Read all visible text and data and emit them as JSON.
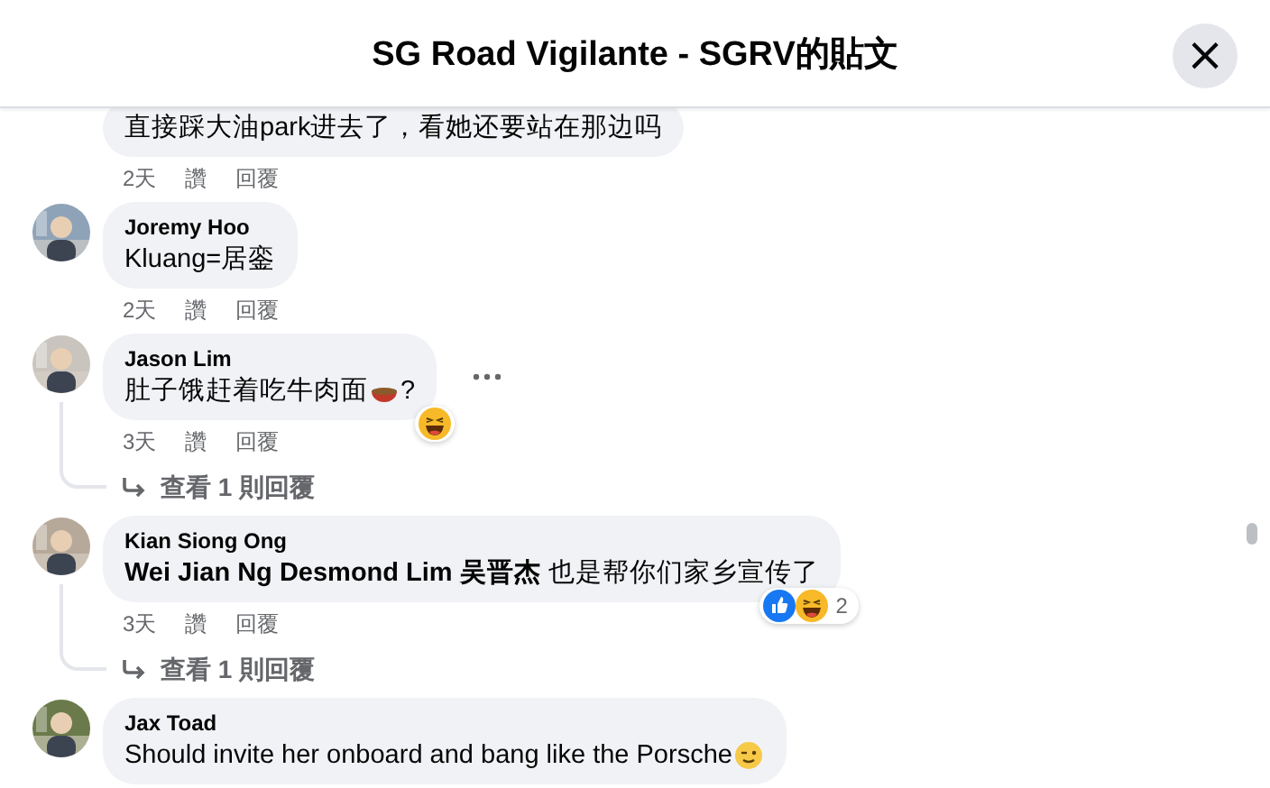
{
  "dialog": {
    "title": "SG Road Vigilante - SGRV的貼文",
    "close": "×"
  },
  "comments": [
    {
      "text": "直接踩大油park进去了，看她还要站在那边吗",
      "time": "2天",
      "actions": [
        "讚",
        "回覆"
      ]
    },
    {
      "author": "Joremy Hoo",
      "text": "Kluang=居銮",
      "time": "2天",
      "actions": [
        "讚",
        "回覆"
      ]
    },
    {
      "author": "Jason Lim",
      "text": "肚子饿赶着吃牛肉面",
      "inline_icon": {
        "kind": "bowl"
      },
      "text_end": "?",
      "time": "3天",
      "actions": [
        "讚",
        "回覆"
      ],
      "more": true,
      "reactions": [
        {
          "kind": "haha"
        }
      ],
      "replies": "查看 1 則回覆"
    },
    {
      "author": "Kian Siong Ong",
      "text": "**Wei Jian Ng Desmond Lim 吴晋杰** 也是帮你们家乡宣传了",
      "time": "3天",
      "actions": [
        "讚",
        "回覆"
      ],
      "reactions": [
        {
          "kind": "like"
        },
        {
          "kind": "haha"
        }
      ],
      "reaction_count": "2",
      "replies": "查看 1 則回覆"
    },
    {
      "author": "Jax Toad",
      "text": "Should invite her onboard and bang like the Porsche",
      "inline_icon": {
        "kind": "wink"
      }
    }
  ]
}
